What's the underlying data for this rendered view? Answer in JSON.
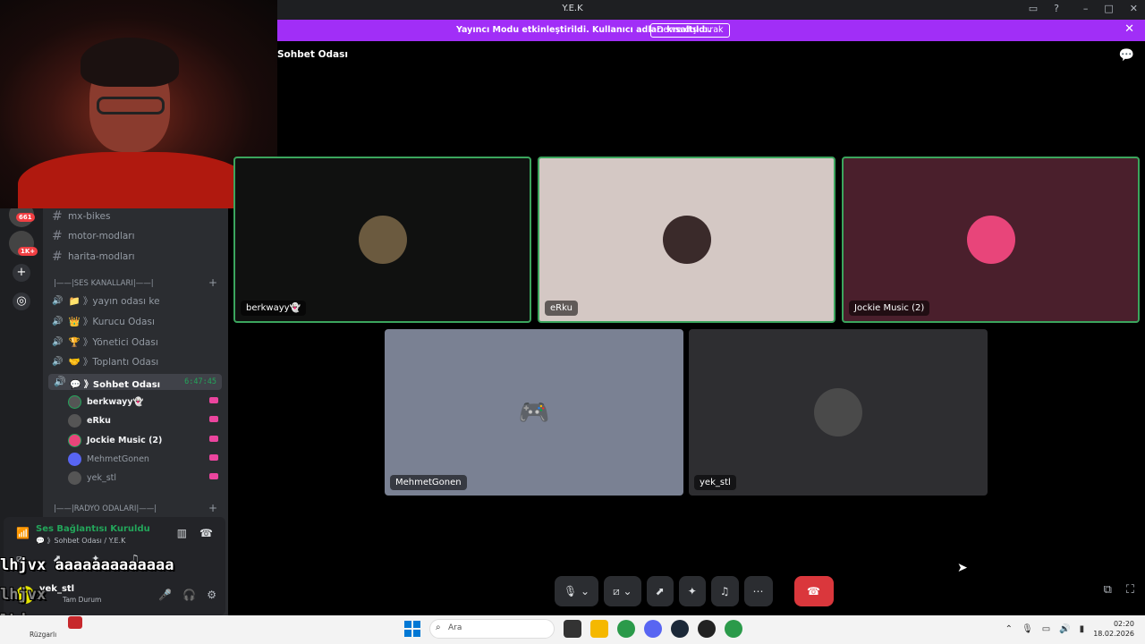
{
  "window": {
    "title": "Y.E.K"
  },
  "banner": {
    "message": "Yayıncı Modu etkinleştirildi. Kullanıcı adları kısaltıldı.",
    "button": "Devre dışı bırak"
  },
  "guilds": {
    "badges": [
      "661",
      "1K+"
    ]
  },
  "channels": {
    "text": [
      "mx-bikes",
      "motor-modları",
      "harita-modları"
    ],
    "voice_category": "|——|SES KANALLARI|——|",
    "voice": [
      "📁 》yayın odası ke",
      "👑 》Kurucu Odası",
      "🏆 》Yönetici Odası",
      "🤝 》Toplantı Odası"
    ],
    "active_voice": "💬 》Sohbet Odası",
    "active_time": "6:47:45",
    "members": [
      "berkwayy👻",
      "eRku",
      "Jockie Music (2)",
      "MehmetGonen",
      "yek_stl"
    ],
    "radio_category": "|——|RADYO ODALARI|——|"
  },
  "voice_panel": {
    "status": "Ses Bağlantısı Kuruldu",
    "sub": "💬 》Sohbet Odası / Y.E.K",
    "username": "yek_stl",
    "user_status": "Tam Durum"
  },
  "overlay": {
    "line1": "lhjvx aaaaaaaaaaaaa",
    "line2": "lhjvx",
    "line3": "lhjvx"
  },
  "stage": {
    "title": "Sohbet Odası",
    "tiles": [
      {
        "label": "berkwayy👻",
        "bg": "#101110",
        "av": "#6b5a3f"
      },
      {
        "label": "eRku",
        "bg": "#d4c8c4",
        "av": "#3a2a2a"
      },
      {
        "label": "Jockie Music (2)",
        "bg": "#4a1f2c",
        "av": "#e8457a"
      },
      {
        "label": "MehmetGonen",
        "bg": "#7a8193",
        "av": "#5865f2"
      },
      {
        "label": "yek_stl",
        "bg": "#2e2e31",
        "av": "#4a4a4a"
      }
    ]
  },
  "taskbar": {
    "weather": "Rüzgarlı",
    "search": "Ara",
    "time": "02:20",
    "date": "18.02.2026"
  },
  "colors": {
    "banner": "#a12ef7",
    "speaking": "#3ba55d",
    "end_call": "#da373c",
    "stream": "#eb459e"
  }
}
